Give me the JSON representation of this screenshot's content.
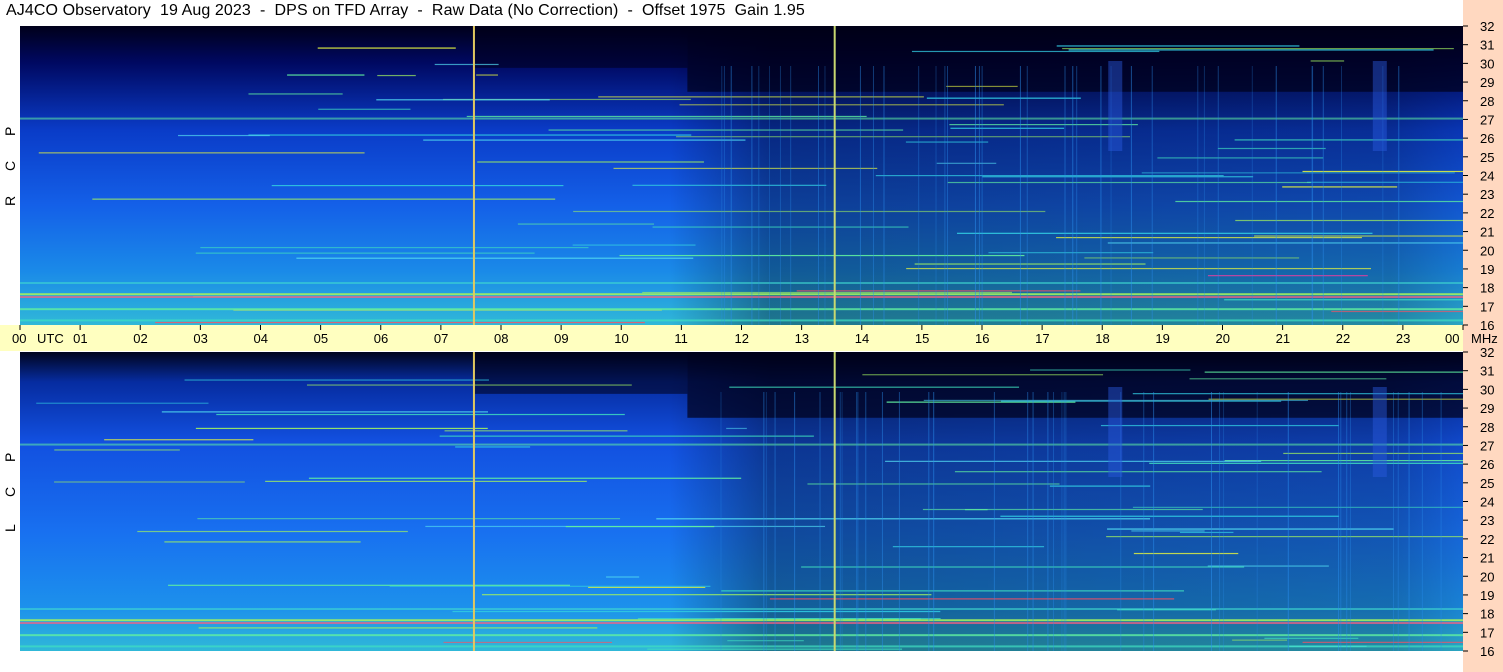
{
  "title": "AJ4CO Observatory  19 Aug 2023  -  DPS on TFD Array  -  Raw Data (No Correction)  -  Offset 1975  Gain 1.95",
  "colors": {
    "background": "#ffffff",
    "time_axis_band": "#ffffc0",
    "freq_axis_band": "#ffd8c0",
    "marker_line_1": "#e0c860",
    "marker_line_2": "#c8d870"
  },
  "chart_data": {
    "type": "heatmap",
    "title": "AJ4CO Observatory  19 Aug 2023  -  DPS on TFD Array  -  Raw Data (No Correction)  -  Offset 1975  Gain 1.95",
    "x_axis": {
      "label_start": "00",
      "unit_label": "UTC",
      "ticks": [
        "00",
        "01",
        "02",
        "03",
        "04",
        "05",
        "06",
        "07",
        "08",
        "09",
        "10",
        "11",
        "12",
        "13",
        "14",
        "15",
        "16",
        "17",
        "18",
        "19",
        "20",
        "21",
        "22",
        "23",
        "00"
      ],
      "range_hours": [
        0,
        24
      ]
    },
    "y_axis": {
      "unit_label": "MHz",
      "range_mhz": [
        16,
        32
      ],
      "ticks": [
        "16",
        "17",
        "18",
        "19",
        "20",
        "21",
        "22",
        "23",
        "24",
        "25",
        "26",
        "27",
        "28",
        "29",
        "30",
        "31",
        "32"
      ]
    },
    "panels": [
      {
        "polarization": "RCP",
        "letters": [
          "R",
          "C",
          "P"
        ]
      },
      {
        "polarization": "LCP",
        "letters": [
          "L",
          "C",
          "P"
        ]
      }
    ],
    "vertical_markers_utc": [
      7.55,
      13.55
    ],
    "notable_features": {
      "strong_band_mhz": 17.7,
      "band_27_mhz": 27.1
    }
  }
}
